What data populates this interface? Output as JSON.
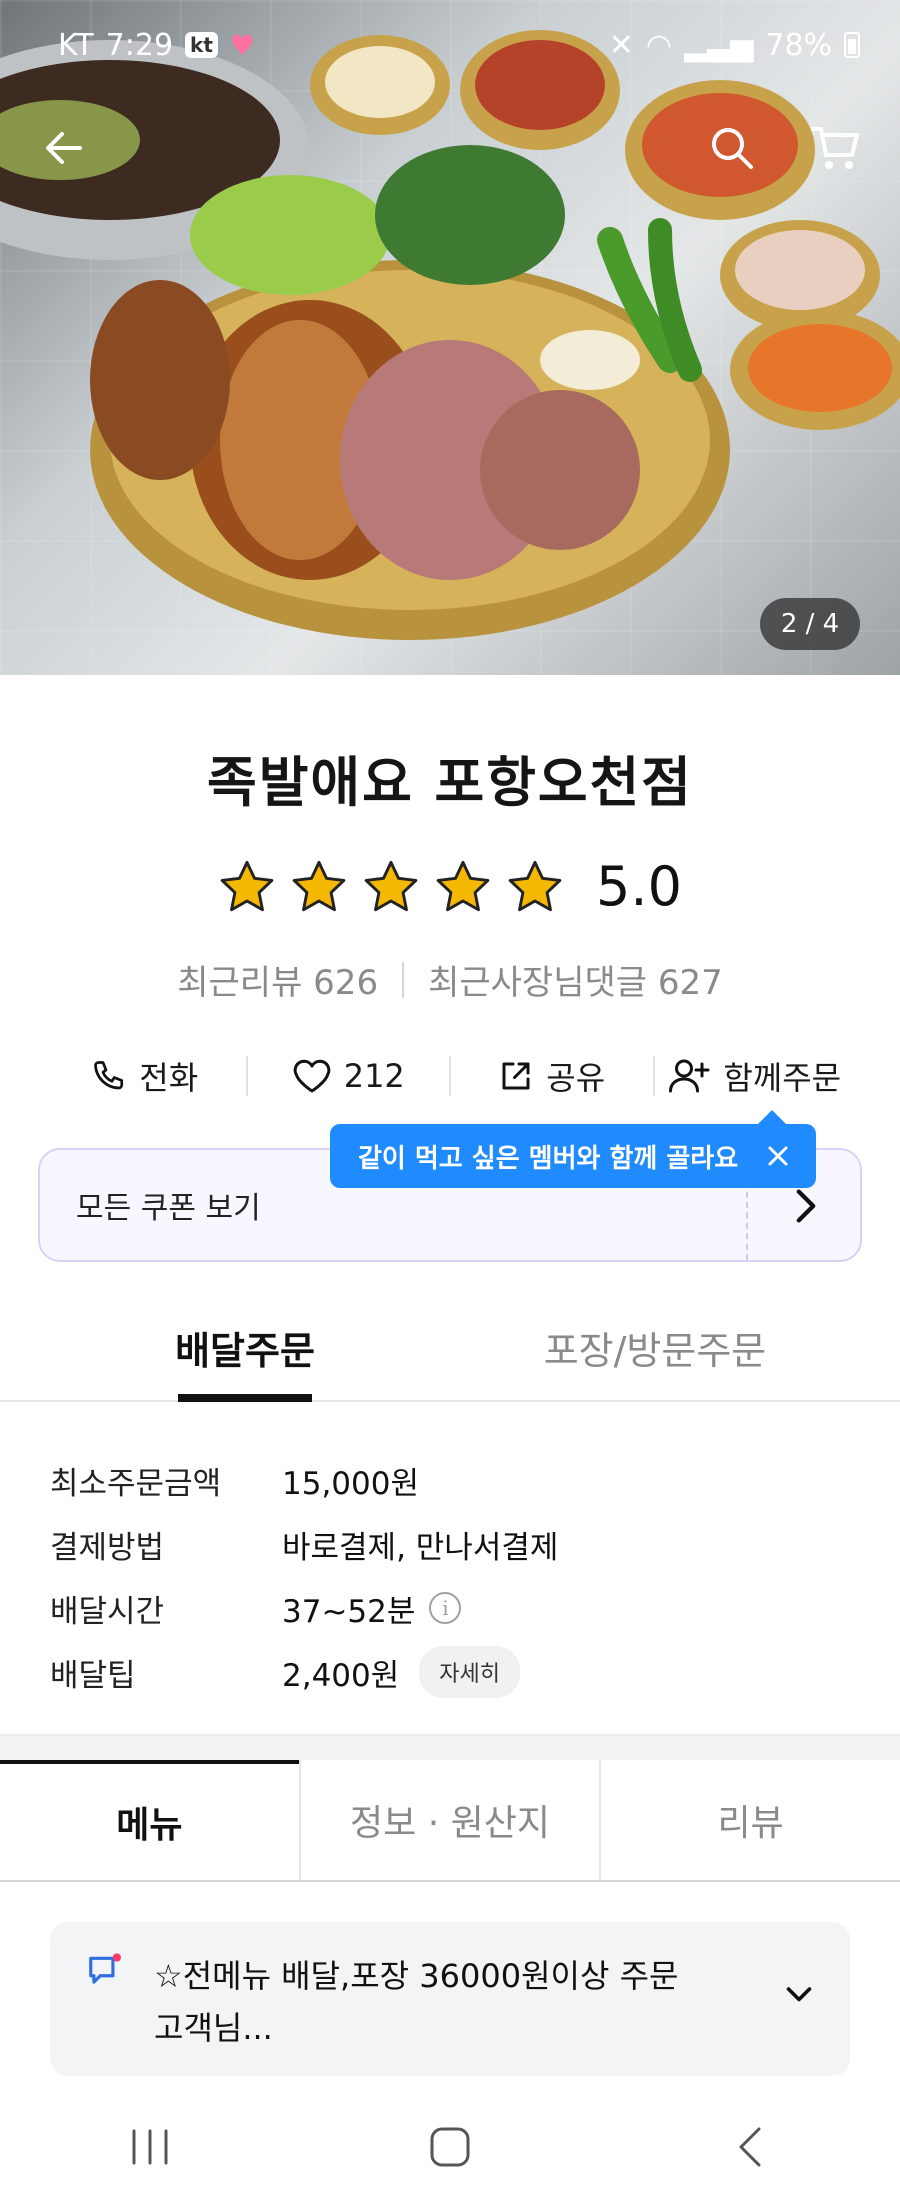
{
  "status_bar": {
    "carrier": "KT",
    "time": "7:29",
    "kt_badge": "kt",
    "battery": "78%"
  },
  "hero": {
    "image_description": "food-photo",
    "page_indicator": "2 / 4"
  },
  "store": {
    "name": "족발애요 포항오천점",
    "rating": 5.0,
    "rating_text": "5.0",
    "stars_filled": 5,
    "recent_reviews": "최근리뷰 626",
    "owner_replies": "최근사장님댓글 627"
  },
  "actions": {
    "call_label": "전화",
    "like_count": "212",
    "share_label": "공유",
    "group_order_label": "함께주문"
  },
  "tooltip": {
    "text": "같이 먹고 싶은 멤버와 함께 골라요"
  },
  "coupon": {
    "label": "모든 쿠폰 보기"
  },
  "order_tabs": {
    "delivery": "배달주문",
    "pickup": "포장/방문주문"
  },
  "info": {
    "min_order_label": "최소주문금액",
    "min_order_value": "15,000원",
    "payment_label": "결제방법",
    "payment_value": "바로결제, 만나서결제",
    "time_label": "배달시간",
    "time_value": "37~52분",
    "tip_label": "배달팁",
    "tip_value": "2,400원",
    "tip_detail": "자세히"
  },
  "menu_tabs": {
    "menu": "메뉴",
    "info": "정보 · 원산지",
    "review": "리뷰"
  },
  "notice": {
    "line1": "☆전메뉴 배달,포장 36000원이상 주문",
    "line2": "고객님..."
  },
  "colors": {
    "accent_blue": "#1f8bff",
    "star": "#f5b800",
    "coupon_bg": "#f8f6ff",
    "notice_icon": "#2f6fe0"
  }
}
